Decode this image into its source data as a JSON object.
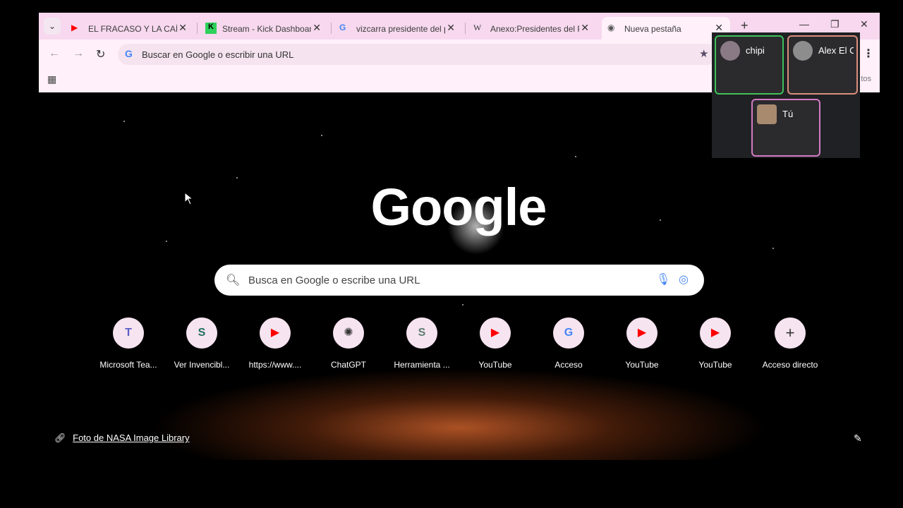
{
  "tabs": [
    {
      "title": "EL FRACASO Y LA CAÍDA",
      "icon": "youtube-icon"
    },
    {
      "title": "Stream - Kick Dashboard",
      "icon": "kick-icon"
    },
    {
      "title": "vizcarra presidente del pe",
      "icon": "google-icon"
    },
    {
      "title": "Anexo:Presidentes del Pe",
      "icon": "wikipedia-icon"
    },
    {
      "title": "Nueva pestaña",
      "icon": "chrome-icon"
    }
  ],
  "toolbar": {
    "omnibox_text": "Buscar en Google o escribir una URL"
  },
  "bookmarks": {
    "right_text": "tos"
  },
  "ntp": {
    "logo": "Google",
    "search_placeholder": "Busca en Google o escribe una URL",
    "shortcuts": [
      {
        "label": "Microsoft Tea...",
        "glyph": "T"
      },
      {
        "label": "Ver Invencibl...",
        "glyph": "S"
      },
      {
        "label": "https://www....",
        "glyph": "▶"
      },
      {
        "label": "ChatGPT",
        "glyph": "✺"
      },
      {
        "label": "Herramienta ...",
        "glyph": "S"
      },
      {
        "label": "YouTube",
        "glyph": "▶"
      },
      {
        "label": "Acceso",
        "glyph": "G"
      },
      {
        "label": "YouTube",
        "glyph": "▶"
      },
      {
        "label": "YouTube",
        "glyph": "▶"
      },
      {
        "label": "Acceso directo",
        "glyph": "+"
      }
    ],
    "credit": "Foto de NASA Image Library"
  },
  "call": {
    "participants": [
      {
        "name": "chipi"
      },
      {
        "name": "Alex El C"
      },
      {
        "name": "Tú"
      }
    ]
  }
}
